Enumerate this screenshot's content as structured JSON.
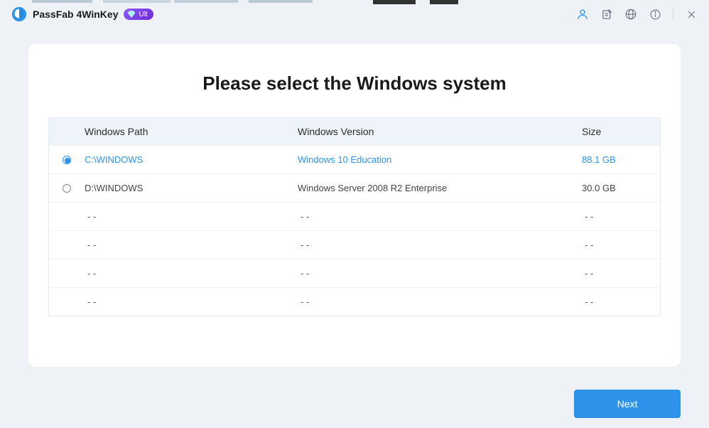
{
  "app": {
    "title": "PassFab 4WinKey",
    "badge": "Ult"
  },
  "heading": "Please select the Windows system",
  "table": {
    "headers": {
      "path": "Windows Path",
      "version": "Windows Version",
      "size": "Size"
    },
    "rows": [
      {
        "selected": true,
        "path": "C:\\WINDOWS",
        "version": "Windows 10 Education",
        "size": "88.1 GB"
      },
      {
        "selected": false,
        "path": "D:\\WINDOWS",
        "version": "Windows Server 2008 R2 Enterprise",
        "size": "30.0 GB"
      },
      {
        "empty": true,
        "path": "- -",
        "version": "- -",
        "size": "- -"
      },
      {
        "empty": true,
        "path": "- -",
        "version": "- -",
        "size": "- -"
      },
      {
        "empty": true,
        "path": "- -",
        "version": "- -",
        "size": "- -"
      },
      {
        "empty": true,
        "path": "- -",
        "version": "- -",
        "size": "- -"
      }
    ]
  },
  "footer": {
    "next": "Next"
  },
  "colors": {
    "accent": "#2c93e8",
    "badge_gradient_start": "#8b5cf6",
    "badge_gradient_end": "#6d28d9",
    "background": "#eef2f6"
  }
}
